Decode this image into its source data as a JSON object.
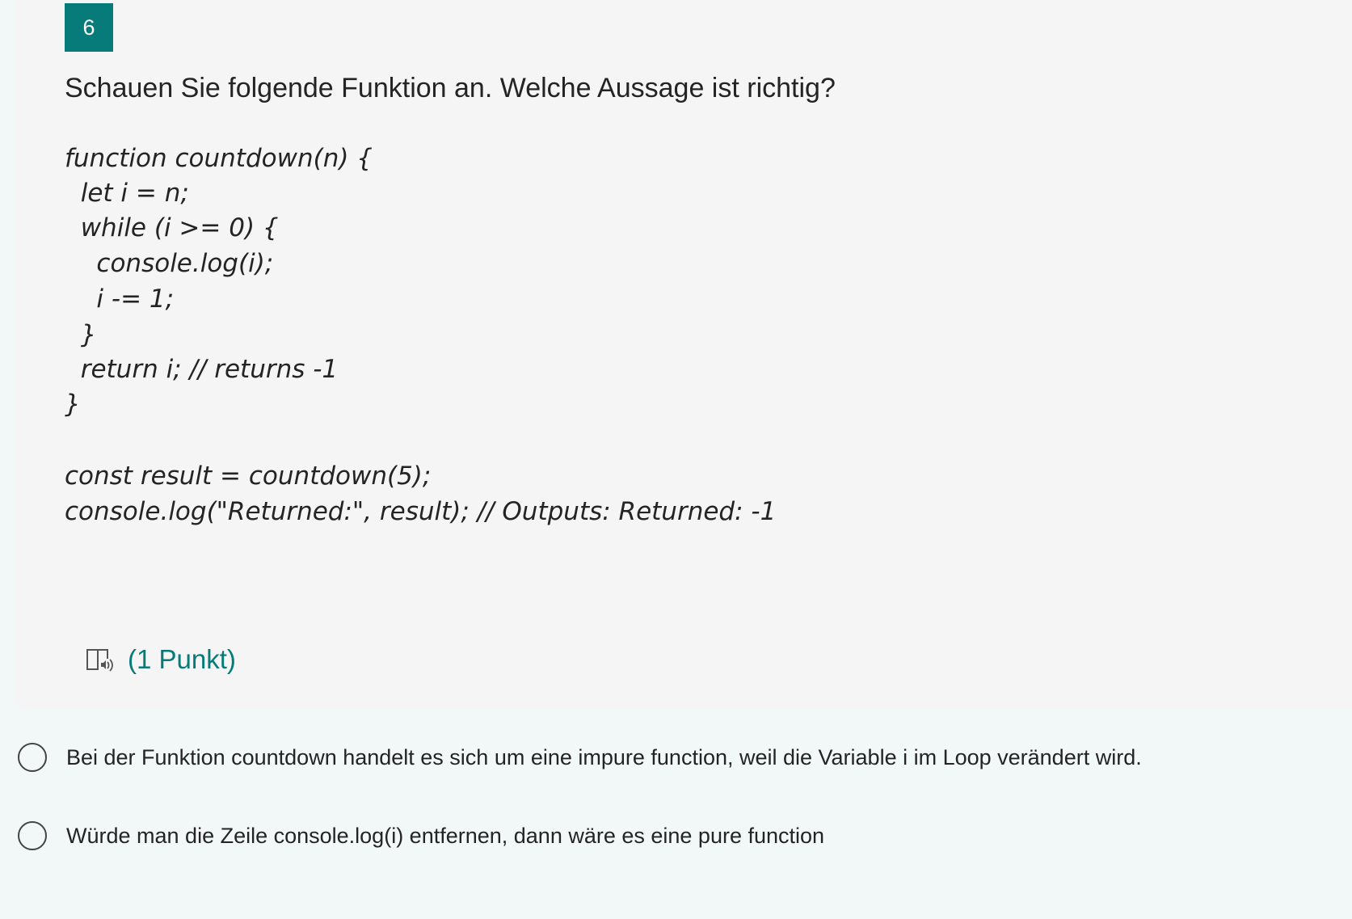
{
  "question": {
    "number": "6",
    "title": "Schauen Sie folgende Funktion an. Welche Aussage ist richtig?",
    "code_lines": [
      "function countdown(n) {",
      "  let i = n;",
      "  while (i >= 0) {",
      "    console.log(i);",
      "    i -= 1;",
      "  }",
      "  return i; // returns -1",
      "}",
      "const result = countdown(5);",
      "console.log(\"Returned:\", result); // Outputs: Returned: -1"
    ],
    "reader_icon": "immersive-reader-icon",
    "points_label": "(1 Punkt)"
  },
  "options": [
    {
      "label": "Bei der Funktion countdown handelt es sich um eine impure function, weil die Variable i im Loop verändert wird.",
      "selected": false
    },
    {
      "label": "Würde man die Zeile console.log(i) entfernen, dann wäre es eine pure function",
      "selected": false
    }
  ],
  "colors": {
    "accent": "#077a7a",
    "card_background": "#f5f5f5",
    "page_background": "#f2f7f8",
    "text": "#242424"
  }
}
